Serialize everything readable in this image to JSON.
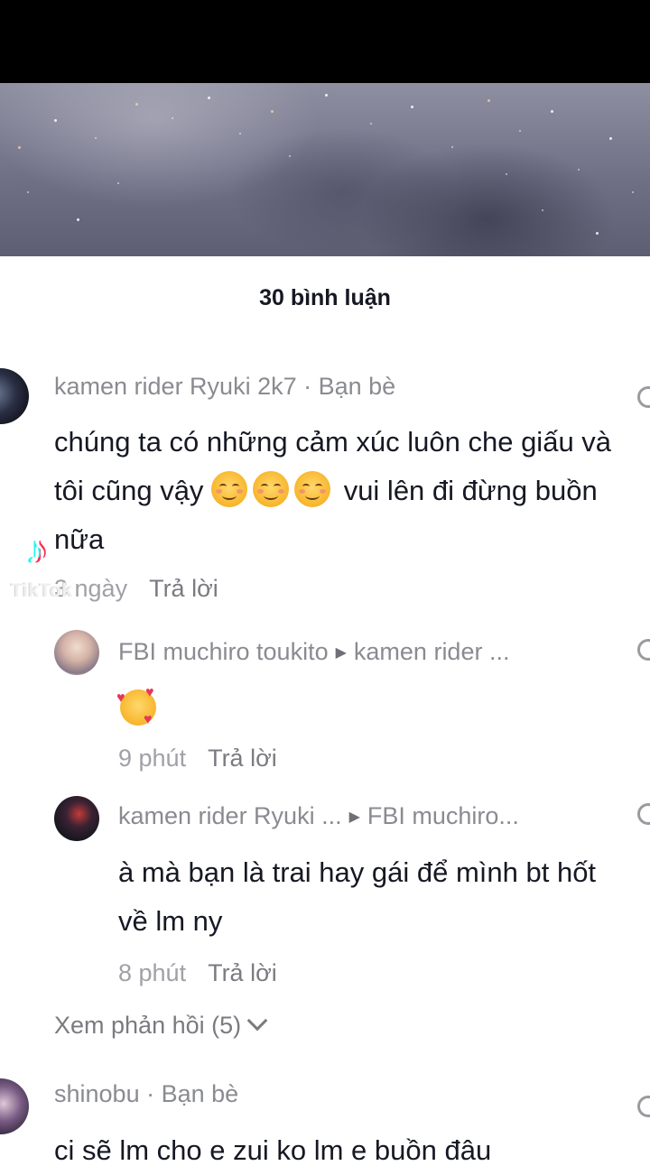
{
  "comments_count": "30 bình luận",
  "friend_label": "Bạn bè",
  "reply_label": "Trả lời",
  "watermark": "TikTok",
  "comments": [
    {
      "username": "kamen rider Ryuki 2k7",
      "text_part1": "chúng ta có những cảm xúc luôn che giấu và tôi cũng vậy",
      "text_part2": "vui lên đi đừng buồn nữa",
      "time": "3 ngày",
      "replies": [
        {
          "username": "FBI muchiro toukito",
          "reply_to": "kamen rider ...",
          "emoji": "smiling-face-with-hearts",
          "time": "9 phút"
        },
        {
          "username": "kamen rider Ryuki ...",
          "reply_to": "FBI muchiro...",
          "text": "à mà bạn là trai hay gái để mình bt hốt về lm ny",
          "time": "8 phút"
        }
      ],
      "view_replies": "Xem phản hồi (5)"
    },
    {
      "username": "shinobu",
      "text": "ci sẽ lm cho e zui ko lm e buồn đâu"
    }
  ]
}
